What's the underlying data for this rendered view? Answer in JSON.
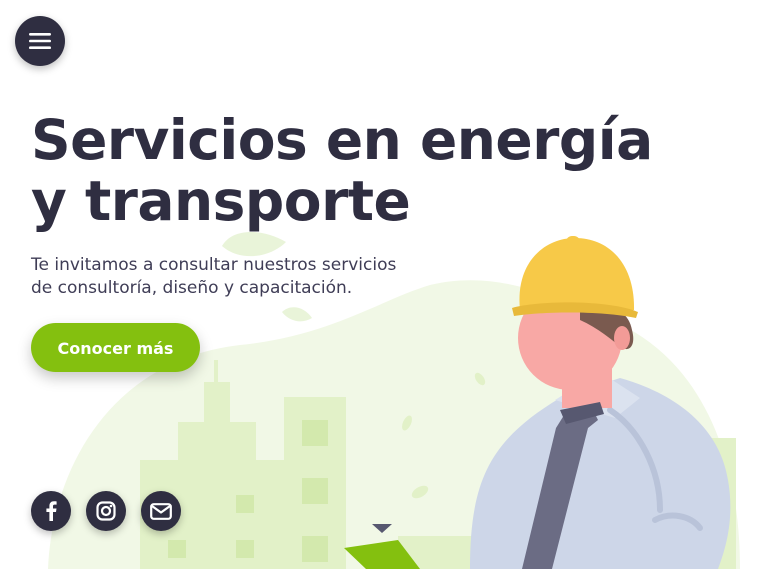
{
  "header": {
    "menu_icon": "hamburger-menu-icon"
  },
  "hero": {
    "title_line1": "Servicios en energía",
    "title_line2": "y transporte",
    "subtitle_line1": "Te invitamos a consultar nuestros servicios",
    "subtitle_line2": "de consultoría, diseño y capacitación.",
    "cta_label": "Conocer más"
  },
  "social": {
    "items": [
      {
        "icon": "facebook-icon"
      },
      {
        "icon": "instagram-icon"
      },
      {
        "icon": "email-icon"
      }
    ]
  },
  "colors": {
    "dark": "#2f2e41",
    "accent": "#84c00f",
    "helmet": "#f7c948",
    "blob": "#f1f8e6",
    "shirt": "#cdd6e8"
  }
}
